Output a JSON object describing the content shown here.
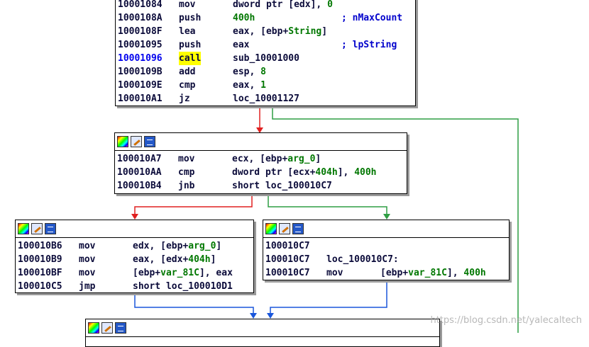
{
  "block1": {
    "lines": [
      {
        "addr": "10001084",
        "mnem": "mov",
        "ops": [
          {
            "t": "dword ptr [edx], "
          },
          {
            "t": "0",
            "c": "num"
          }
        ],
        "comment": ""
      },
      {
        "addr": "1000108A",
        "mnem": "push",
        "ops": [
          {
            "t": "400h",
            "c": "num"
          }
        ],
        "comment": "; nMaxCount"
      },
      {
        "addr": "1000108F",
        "mnem": "lea",
        "ops": [
          {
            "t": "eax, [ebp+"
          },
          {
            "t": "String",
            "c": "sym"
          },
          {
            "t": "]"
          }
        ],
        "comment": ""
      },
      {
        "addr": "10001095",
        "mnem": "push",
        "ops": [
          {
            "t": "eax"
          }
        ],
        "comment": "; lpString"
      },
      {
        "addr": "10001096",
        "mnem": "call",
        "ops": [
          {
            "t": "sub_10001000"
          }
        ],
        "comment": "",
        "highlight": true
      },
      {
        "addr": "1000109B",
        "mnem": "add",
        "ops": [
          {
            "t": "esp, "
          },
          {
            "t": "8",
            "c": "num"
          }
        ],
        "comment": ""
      },
      {
        "addr": "1000109E",
        "mnem": "cmp",
        "ops": [
          {
            "t": "eax, "
          },
          {
            "t": "1",
            "c": "num"
          }
        ],
        "comment": ""
      },
      {
        "addr": "100010A1",
        "mnem": "jz",
        "ops": [
          {
            "t": "loc_10001127"
          }
        ],
        "comment": ""
      }
    ]
  },
  "block2": {
    "lines": [
      {
        "addr": "100010A7",
        "mnem": "mov",
        "ops": [
          {
            "t": "ecx, [ebp+"
          },
          {
            "t": "arg_0",
            "c": "sym"
          },
          {
            "t": "]"
          }
        ],
        "comment": ""
      },
      {
        "addr": "100010AA",
        "mnem": "cmp",
        "ops": [
          {
            "t": "dword ptr [ecx+"
          },
          {
            "t": "404h",
            "c": "num"
          },
          {
            "t": "], "
          },
          {
            "t": "400h",
            "c": "num"
          }
        ],
        "comment": ""
      },
      {
        "addr": "100010B4",
        "mnem": "jnb",
        "ops": [
          {
            "t": "short loc_100010C7"
          }
        ],
        "comment": ""
      }
    ]
  },
  "block3": {
    "lines": [
      {
        "addr": "100010B6",
        "mnem": "mov",
        "ops": [
          {
            "t": "edx, [ebp+"
          },
          {
            "t": "arg_0",
            "c": "sym"
          },
          {
            "t": "]"
          }
        ],
        "comment": ""
      },
      {
        "addr": "100010B9",
        "mnem": "mov",
        "ops": [
          {
            "t": "eax, [edx+"
          },
          {
            "t": "404h",
            "c": "num"
          },
          {
            "t": "]"
          }
        ],
        "comment": ""
      },
      {
        "addr": "100010BF",
        "mnem": "mov",
        "ops": [
          {
            "t": "[ebp+"
          },
          {
            "t": "var_81C",
            "c": "sym"
          },
          {
            "t": "], eax"
          }
        ],
        "comment": ""
      },
      {
        "addr": "100010C5",
        "mnem": "jmp",
        "ops": [
          {
            "t": "short loc_100010D1"
          }
        ],
        "comment": ""
      }
    ]
  },
  "block4": {
    "lines": [
      {
        "addr": "100010C7",
        "mnem": "",
        "ops": [],
        "comment": ""
      },
      {
        "addr": "100010C7",
        "mnem": "loc_100010C7:",
        "ops": [],
        "comment": ""
      },
      {
        "addr": "100010C7",
        "mnem": "mov",
        "ops": [
          {
            "t": "[ebp+"
          },
          {
            "t": "var_81C",
            "c": "sym"
          },
          {
            "t": "], "
          },
          {
            "t": "400h",
            "c": "num"
          }
        ],
        "comment": ""
      }
    ]
  },
  "watermark": "https://blog.csdn.net/yalecaltech",
  "colors": {
    "edge_true": "#2f9e44",
    "edge_false": "#e02020",
    "edge_uncond": "#1a56db",
    "call_highlight": "#ffff00"
  }
}
